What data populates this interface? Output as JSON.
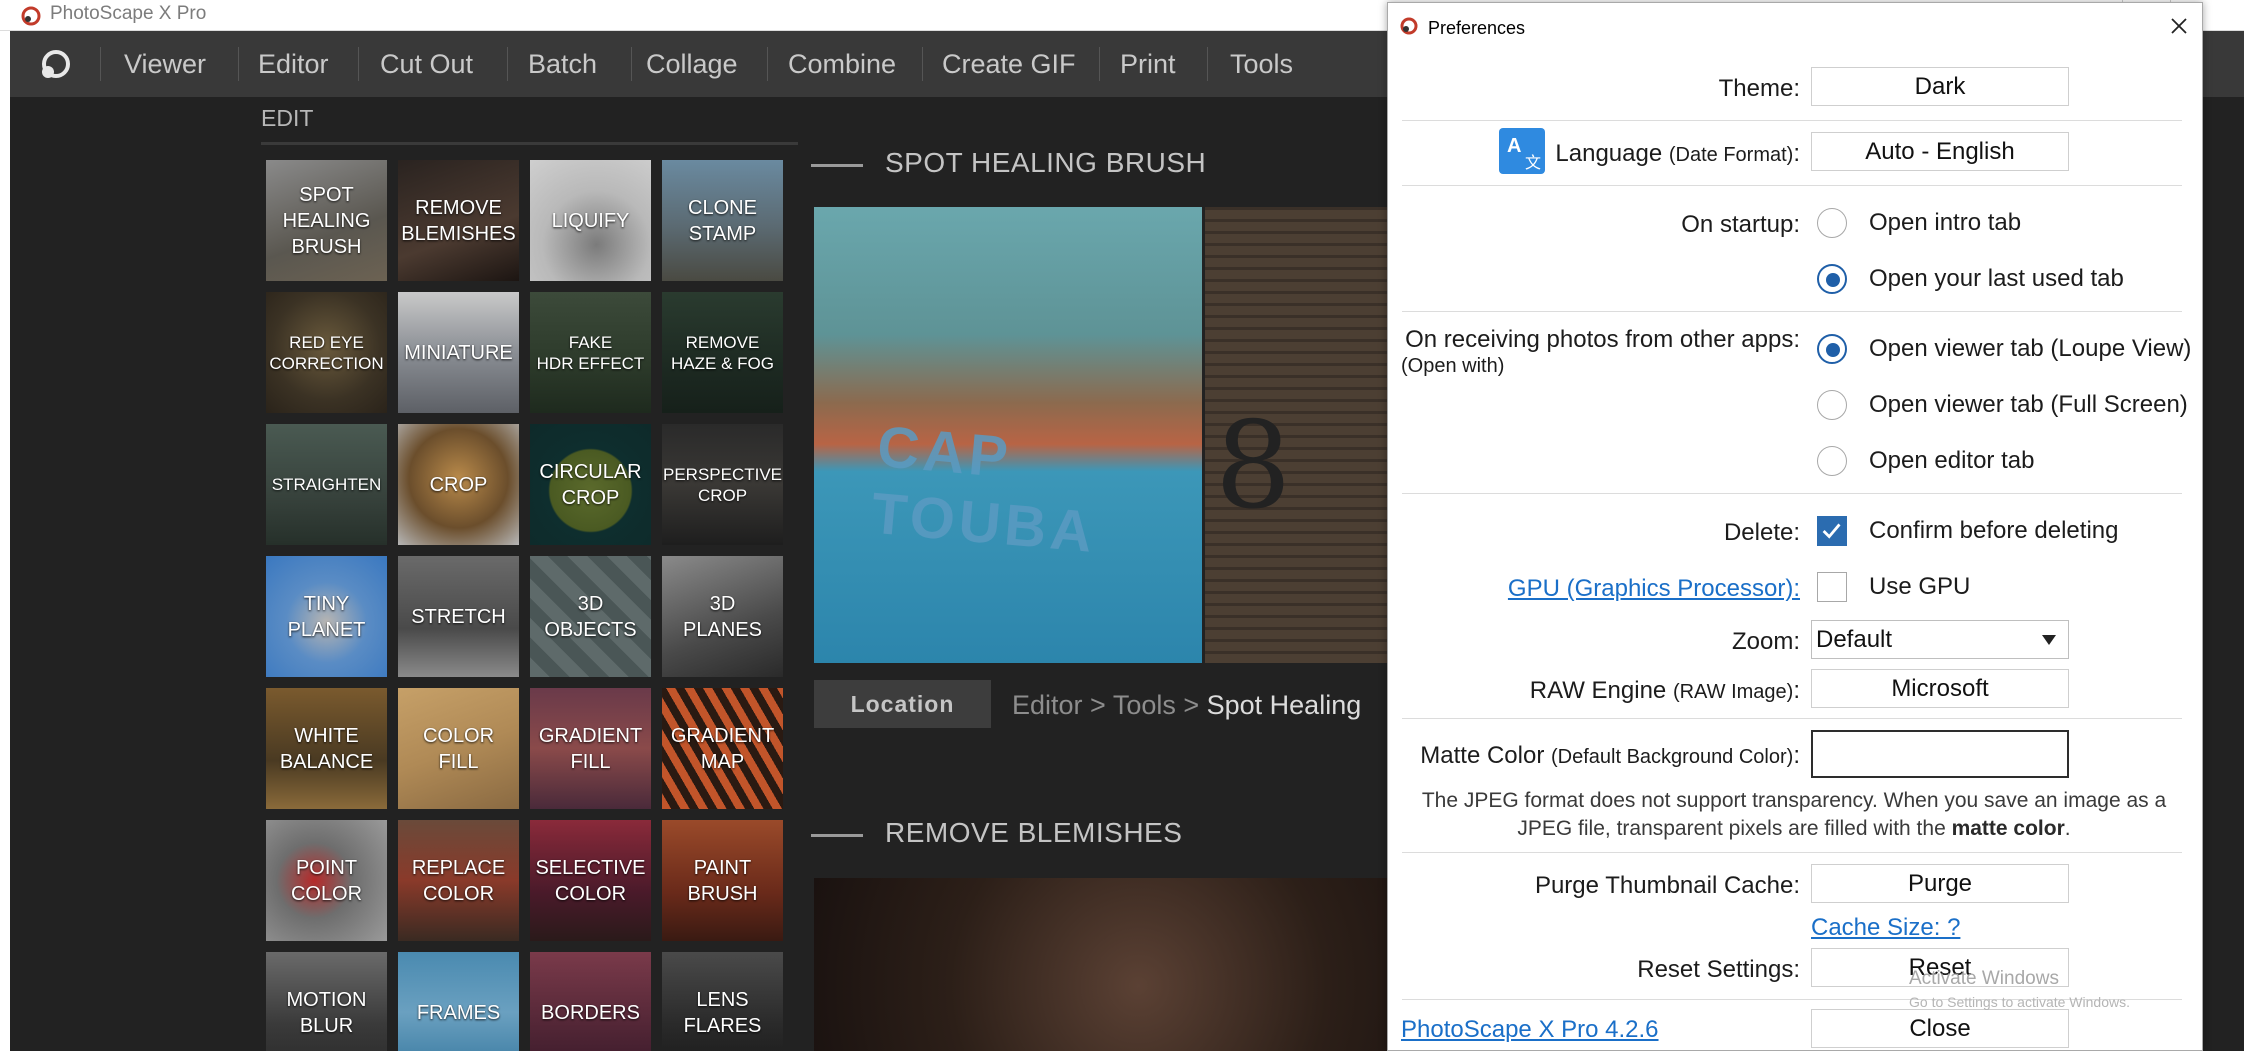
{
  "app": {
    "title": "PhotoScape X Pro",
    "brand_color": "#c23b2a"
  },
  "menu": {
    "items": [
      "Viewer",
      "Editor",
      "Cut Out",
      "Batch",
      "Collage",
      "Combine",
      "Create GIF",
      "Print",
      "Tools"
    ]
  },
  "edit": {
    "label": "EDIT",
    "tiles": [
      "SPOT\nHEALING\nBRUSH",
      "REMOVE\nBLEMISHES",
      "LIQUIFY",
      "CLONE\nSTAMP",
      "RED EYE\nCORRECTION",
      "MINIATURE",
      "FAKE\nHDR EFFECT",
      "REMOVE\nHAZE & FOG",
      "STRAIGHTEN",
      "CROP",
      "CIRCULAR\nCROP",
      "PERSPECTIVE\nCROP",
      "TINY\nPLANET",
      "STRETCH",
      "3D\nOBJECTS",
      "3D\nPLANES",
      "WHITE\nBALANCE",
      "COLOR\nFILL",
      "GRADIENT\nFILL",
      "GRADIENT\nMAP",
      "POINT\nCOLOR",
      "REPLACE\nCOLOR",
      "SELECTIVE\nCOLOR",
      "PAINT\nBRUSH",
      "MOTION\nBLUR",
      "FRAMES",
      "BORDERS",
      "LENS\nFLARES"
    ]
  },
  "spot": {
    "title": "SPOT HEALING BRUSH",
    "image_text": "CAP TOUBA",
    "image_number": "8",
    "location_label": "Location",
    "path_prefix": "Editor > Tools > ",
    "path_last": "Spot Healing"
  },
  "blemishes": {
    "title": "REMOVE BLEMISHES"
  },
  "prefs": {
    "title": "Preferences",
    "theme": {
      "label": "Theme:",
      "value": "Dark"
    },
    "language": {
      "label": "Language",
      "sub": "(Date Format)",
      "colon": ":",
      "value": "Auto - English",
      "icon_text": "A"
    },
    "startup": {
      "label": "On startup:",
      "options": [
        "Open intro tab",
        "Open your last used tab"
      ],
      "selected": 1
    },
    "receiving": {
      "label": "On receiving photos from other apps:",
      "sub": "(Open with)",
      "options": [
        "Open viewer tab (Loupe View)",
        "Open viewer tab (Full Screen)",
        "Open editor tab"
      ],
      "selected": 0
    },
    "delete": {
      "label": "Delete:",
      "option": "Confirm before deleting",
      "checked": true
    },
    "gpu": {
      "label": "GPU (Graphics Processor):",
      "option": "Use GPU",
      "checked": false
    },
    "zoom": {
      "label": "Zoom:",
      "value": "Default"
    },
    "raw": {
      "label": "RAW Engine",
      "sub": "(RAW Image)",
      "colon": ":",
      "value": "Microsoft"
    },
    "matte": {
      "label": "Matte Color",
      "sub": "(Default Background Color)",
      "colon": ":",
      "value_color": "#ffffff"
    },
    "jpeg_note": {
      "line1": "The JPEG format does not support transparency. When you save an image as a",
      "line2_pre": "JPEG file, transparent pixels are filled with the ",
      "line2_bold": "matte color",
      "line2_post": "."
    },
    "purge": {
      "label": "Purge Thumbnail Cache:",
      "button": "Purge",
      "cache_link": "Cache Size: ?"
    },
    "reset": {
      "label": "Reset Settings:",
      "button": "Reset"
    },
    "version_link": "PhotoScape X Pro 4.2.6",
    "close_button": "Close",
    "watermark_title": "Activate Windows",
    "watermark_sub": "Go to Settings to activate Windows."
  }
}
